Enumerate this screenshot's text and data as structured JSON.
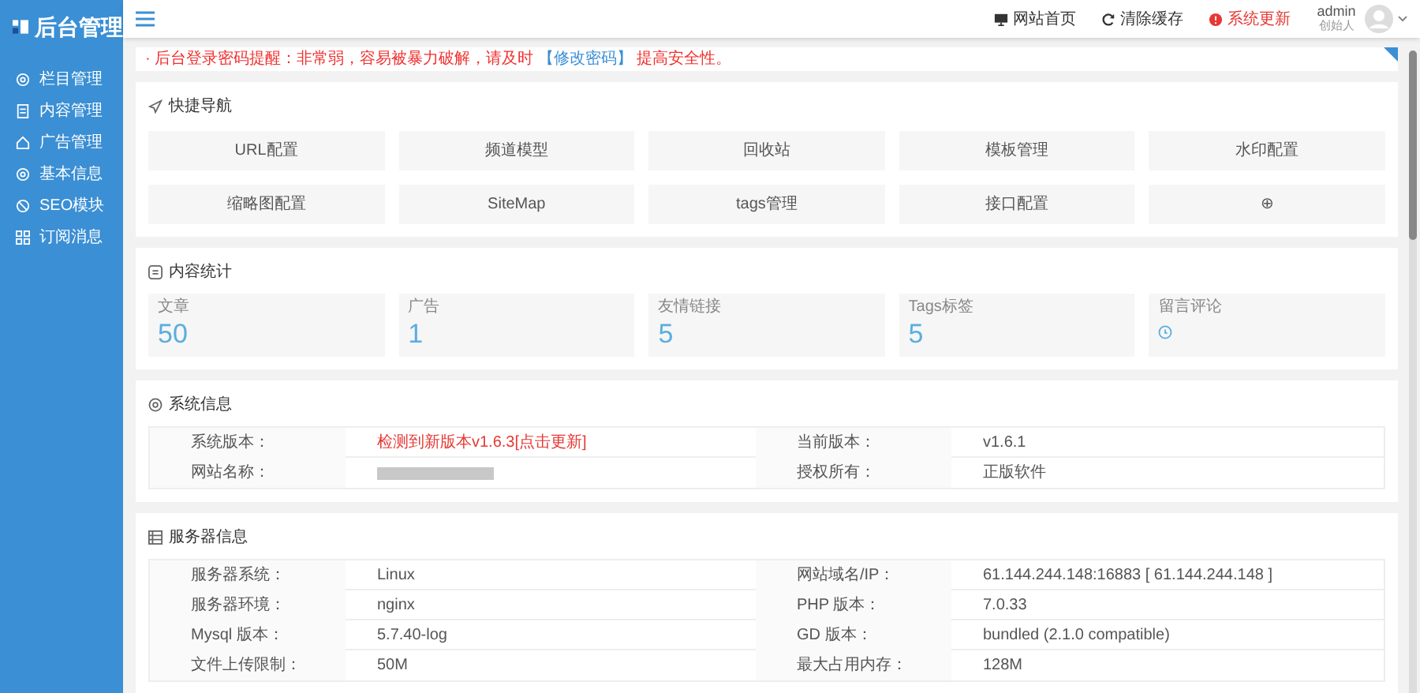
{
  "logo": {
    "text": "后台管理"
  },
  "sidebar": {
    "items": [
      {
        "label": "栏目管理"
      },
      {
        "label": "内容管理"
      },
      {
        "label": "广告管理"
      },
      {
        "label": "基本信息"
      },
      {
        "label": "SEO模块"
      },
      {
        "label": "订阅消息"
      }
    ]
  },
  "header": {
    "links": [
      {
        "label": "网站首页",
        "alert": false
      },
      {
        "label": "清除缓存",
        "alert": false
      },
      {
        "label": "系统更新",
        "alert": true
      }
    ],
    "user": {
      "name": "admin",
      "role": "创始人"
    }
  },
  "notice": {
    "prefix": "· 后台登录密码提醒：非常弱，容易被暴力破解，请及时",
    "link": "【修改密码】",
    "suffix": "提高安全性。"
  },
  "quick_nav": {
    "title": "快捷导航",
    "items": [
      "URL配置",
      "频道模型",
      "回收站",
      "模板管理",
      "水印配置",
      "缩略图配置",
      "SiteMap",
      "tags管理",
      "接口配置",
      "⊕"
    ]
  },
  "stats": {
    "title": "内容统计",
    "items": [
      {
        "label": "文章",
        "kind": "number",
        "value": "50"
      },
      {
        "label": "广告",
        "kind": "number",
        "value": "1"
      },
      {
        "label": "友情链接",
        "kind": "number",
        "value": "5"
      },
      {
        "label": "Tags标签",
        "kind": "number",
        "value": "5"
      },
      {
        "label": "留言评论",
        "kind": "icon"
      }
    ]
  },
  "system_info": {
    "title": "系统信息",
    "rows": [
      [
        {
          "label": "系统版本：",
          "value": "检测到新版本v1.6.3[点击更新]",
          "alert": true,
          "kind": "text"
        },
        {
          "label": "当前版本：",
          "value": "v1.6.1",
          "kind": "text"
        }
      ],
      [
        {
          "label": "网站名称：",
          "kind": "redacted"
        },
        {
          "label": "授权所有：",
          "value": "正版软件",
          "kind": "text"
        }
      ]
    ]
  },
  "server_info": {
    "title": "服务器信息",
    "rows": [
      [
        {
          "label": "服务器系统：",
          "value": "Linux"
        },
        {
          "label": "网站域名/IP：",
          "value": "61.144.244.148:16883 [ 61.144.244.148 ]"
        }
      ],
      [
        {
          "label": "服务器环境：",
          "value": "nginx"
        },
        {
          "label": "PHP 版本：",
          "value": "7.0.33"
        }
      ],
      [
        {
          "label": "Mysql 版本：",
          "value": "5.7.40-log"
        },
        {
          "label": "GD 版本：",
          "value": "bundled (2.1.0 compatible)"
        }
      ],
      [
        {
          "label": "文件上传限制：",
          "value": "50M"
        },
        {
          "label": "最大占用内存：",
          "value": "128M"
        }
      ]
    ]
  }
}
